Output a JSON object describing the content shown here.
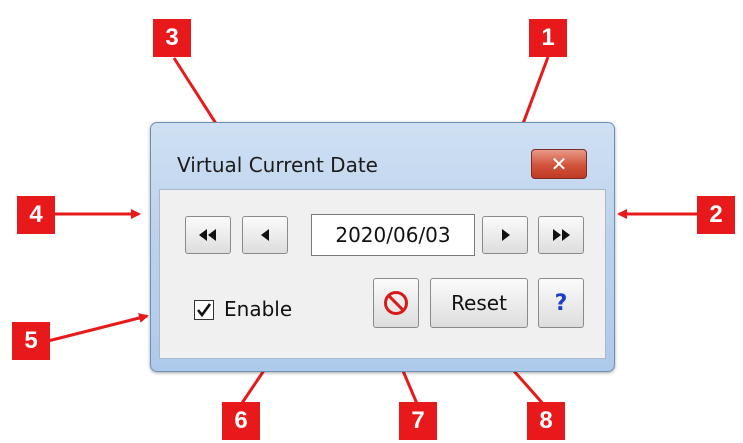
{
  "window": {
    "title": "Virtual Current Date"
  },
  "controls": {
    "date_value": "2020/06/03",
    "enable_label": "Enable",
    "enable_checked": true,
    "reset_label": "Reset",
    "help_label": "?"
  },
  "icons": {
    "close": "close-icon",
    "first": "double-left-arrow-icon",
    "prev": "left-arrow-icon",
    "next": "right-arrow-icon",
    "last": "double-right-arrow-icon",
    "clear": "no-symbol-icon",
    "checkmark": "checkmark-icon"
  },
  "callouts": [
    "1",
    "2",
    "3",
    "4",
    "5",
    "6",
    "7",
    "8"
  ],
  "colors": {
    "callout": "#e8191b",
    "close_button": "#d2533c",
    "help": "#1a3fc9"
  }
}
